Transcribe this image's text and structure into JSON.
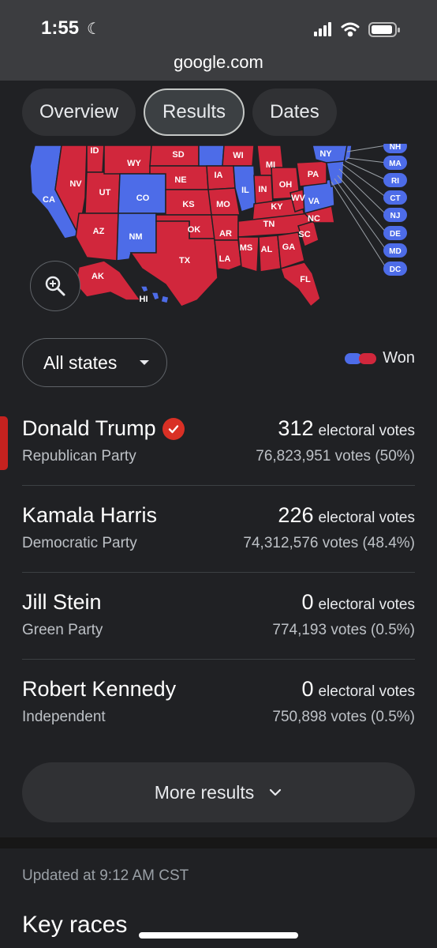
{
  "status": {
    "time": "1:55",
    "url": "google.com"
  },
  "tabs": [
    {
      "label": "Overview"
    },
    {
      "label": "Results"
    },
    {
      "label": "Dates"
    }
  ],
  "map": {
    "states_visible": [
      "ID",
      "WY",
      "SD",
      "WI",
      "MI",
      "NY",
      "NV",
      "UT",
      "CO",
      "NE",
      "IA",
      "IL",
      "IN",
      "OH",
      "PA",
      "CA",
      "KS",
      "MO",
      "KY",
      "WV",
      "VA",
      "AZ",
      "NM",
      "OK",
      "AR",
      "TN",
      "NC",
      "SC",
      "MS",
      "AL",
      "GA",
      "TX",
      "LA",
      "FL",
      "AK",
      "HI"
    ],
    "east_badges": [
      "NH",
      "MA",
      "RI",
      "CT",
      "NJ",
      "DE",
      "MD",
      "DC"
    ]
  },
  "filter": {
    "label": "All states"
  },
  "legend": {
    "label": "Won"
  },
  "colors": {
    "rep": "#d1273c",
    "dem": "#4d6ce8",
    "background": "#202124"
  },
  "candidates": [
    {
      "name": "Donald Trump",
      "party": "Republican Party",
      "ev": "312",
      "ev_label": "electoral votes",
      "votes": "76,823,951 votes (50%)"
    },
    {
      "name": "Kamala Harris",
      "party": "Democratic Party",
      "ev": "226",
      "ev_label": "electoral votes",
      "votes": "74,312,576 votes (48.4%)"
    },
    {
      "name": "Jill Stein",
      "party": "Green Party",
      "ev": "0",
      "ev_label": "electoral votes",
      "votes": "774,193 votes (0.5%)"
    },
    {
      "name": "Robert Kennedy",
      "party": "Independent",
      "ev": "0",
      "ev_label": "electoral votes",
      "votes": "750,898 votes (0.5%)"
    }
  ],
  "more": {
    "label": "More results"
  },
  "updated": "Updated at 9:12 AM CST",
  "key_races": "Key races"
}
